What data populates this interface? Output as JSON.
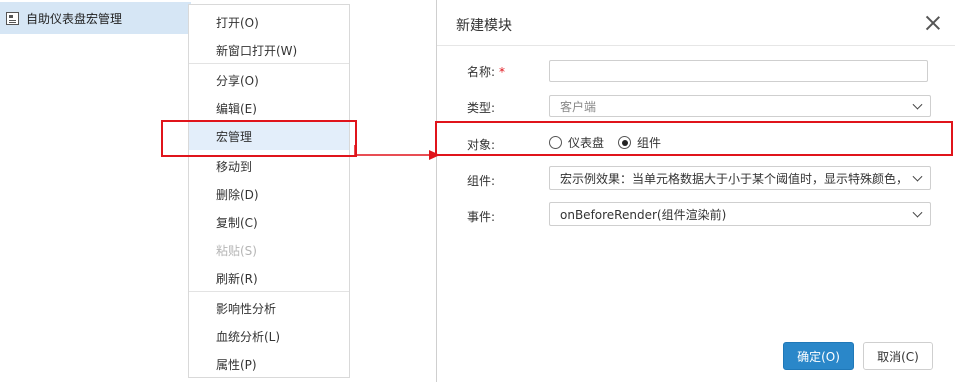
{
  "tree": {
    "item_label": "自助仪表盘宏管理"
  },
  "menu": {
    "items": [
      {
        "label": "打开(O)"
      },
      {
        "label": "新窗口打开(W)"
      },
      {
        "label": "分享(O)"
      },
      {
        "label": "编辑(E)"
      },
      {
        "label": "宏管理"
      },
      {
        "label": "移动到"
      },
      {
        "label": "删除(D)"
      },
      {
        "label": "复制(C)"
      },
      {
        "label": "粘贴(S)"
      },
      {
        "label": "刷新(R)"
      },
      {
        "label": "影响性分析"
      },
      {
        "label": "血统分析(L)"
      },
      {
        "label": "属性(P)"
      }
    ]
  },
  "dialog": {
    "title": "新建模块",
    "name_label": "名称:",
    "name_required": "*",
    "name_value": "",
    "type_label": "类型:",
    "type_value": "客户端",
    "target_label": "对象:",
    "target_options": [
      "仪表盘",
      "组件"
    ],
    "target_selected": "组件",
    "component_label": "组件:",
    "component_value": "宏示例效果：当单元格数据大于小于某个阈值时，显示特殊颜色，",
    "event_label": "事件:",
    "event_value": "onBeforeRender(组件渲染前)",
    "ok_label": "确定(O)",
    "cancel_label": "取消(C)"
  },
  "colors": {
    "highlight": "#e0141b",
    "primary_button": "#2a87c9",
    "tree_selected": "#d6e6f5",
    "menu_hover": "#e3eefa"
  }
}
